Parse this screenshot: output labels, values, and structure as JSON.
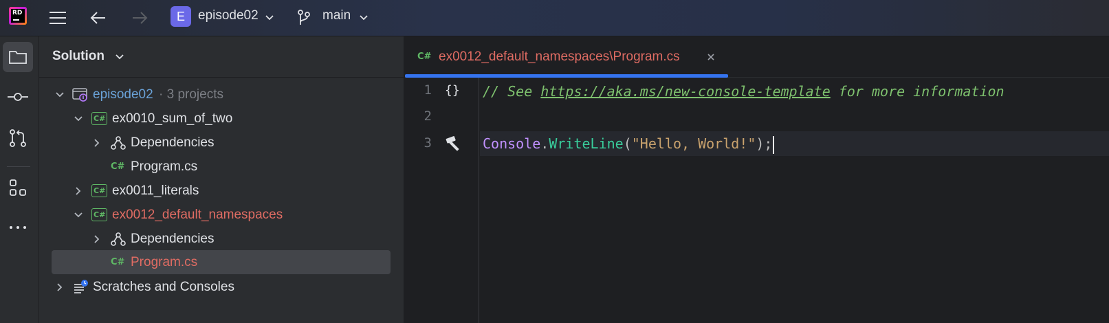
{
  "titlebar": {
    "logo_text": "RD",
    "project_initial": "E",
    "project_name": "episode02",
    "branch": "main"
  },
  "solution_panel": {
    "title": "Solution",
    "tree": [
      {
        "label": "episode02",
        "suffix": "· 3 projects",
        "icon": "solution-icon",
        "expanded": true
      },
      {
        "label": "ex0010_sum_of_two",
        "icon": "csharp-project-icon",
        "expanded": true
      },
      {
        "label": "Dependencies",
        "icon": "dependencies-icon",
        "expanded": false
      },
      {
        "label": "Program.cs",
        "icon": "csharp-file-icon"
      },
      {
        "label": "ex0011_literals",
        "icon": "csharp-project-icon",
        "expanded": false
      },
      {
        "label": "ex0012_default_namespaces",
        "icon": "csharp-project-icon",
        "expanded": true
      },
      {
        "label": "Dependencies",
        "icon": "dependencies-icon",
        "expanded": false
      },
      {
        "label": "Program.cs",
        "icon": "csharp-file-icon",
        "selected": true
      },
      {
        "label": "Scratches and Consoles",
        "icon": "scratches-icon",
        "expanded": false
      }
    ]
  },
  "editor": {
    "tab": {
      "icon_text": "C#",
      "label": "ex0012_default_namespaces\\Program.cs"
    },
    "lines": [
      {
        "number": "1",
        "comment_prefix": "// See ",
        "link": "https://aka.ms/new-console-template",
        "comment_suffix": " for more information"
      },
      {
        "number": "2"
      },
      {
        "number": "3",
        "class_name": "Console",
        "dot": ".",
        "method": "WriteLine",
        "open": "(",
        "string": "\"Hello, World!\"",
        "close": ");"
      }
    ]
  },
  "colors": {
    "accent": "#3574f0",
    "error_red": "#e06c63",
    "csharp_green": "#5fb865",
    "project_badge": "#6b69e8"
  }
}
